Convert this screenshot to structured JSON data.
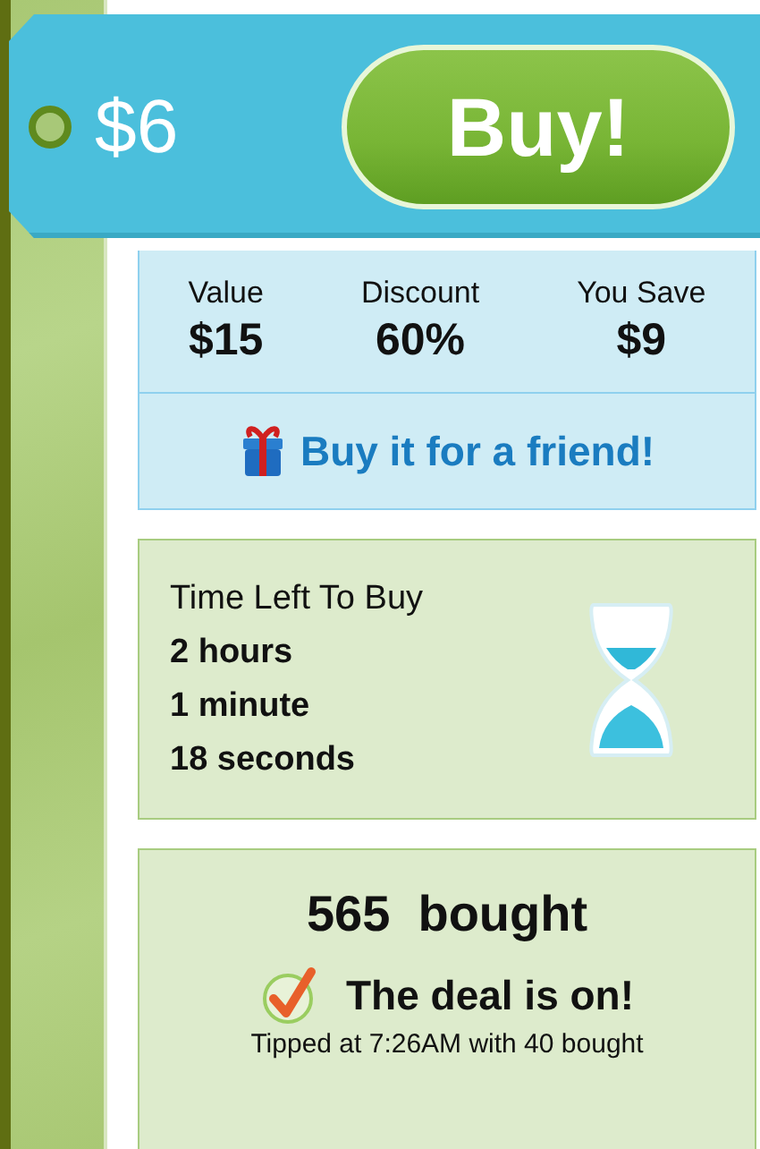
{
  "price_tag": {
    "price": "$6",
    "buy_button": "Buy!"
  },
  "stats": [
    {
      "label": "Value",
      "value": "$15"
    },
    {
      "label": "Discount",
      "value": "60%"
    },
    {
      "label": "You Save",
      "value": "$9"
    }
  ],
  "gift_link": "Buy it for a friend!",
  "timer": {
    "title": "Time Left To Buy",
    "lines": [
      "2 hours",
      "1 minute",
      "18 seconds"
    ]
  },
  "bought": {
    "count": "565  bought",
    "status": "The deal is on!",
    "tipped": "Tipped at 7:26AM with 40 bought"
  }
}
